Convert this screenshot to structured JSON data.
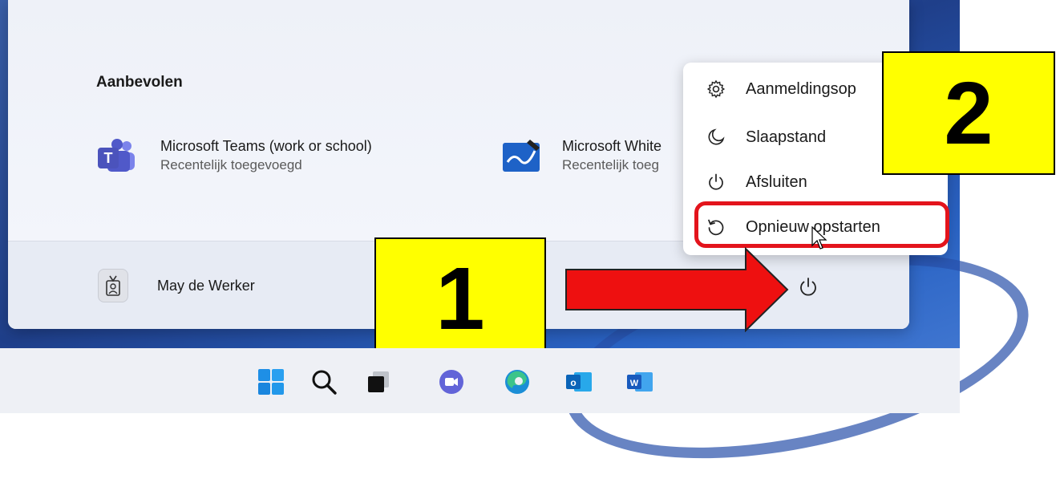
{
  "start_menu": {
    "recommended_title": "Aanbevolen",
    "items": [
      {
        "name": "Microsoft Teams (work or school)",
        "sub": "Recentelijk toegevoegd",
        "icon": "teams-icon"
      },
      {
        "name": "Microsoft White",
        "sub": "Recentelijk toeg",
        "icon": "whiteboard-icon"
      }
    ],
    "user_name": "May de Werker"
  },
  "power_menu": {
    "items": [
      {
        "label": "Aanmeldingsop",
        "icon": "gear-icon"
      },
      {
        "label": "Slaapstand",
        "icon": "moon-icon"
      },
      {
        "label": "Afsluiten",
        "icon": "power-icon"
      },
      {
        "label": "Opnieuw opstarten",
        "icon": "restart-icon"
      }
    ]
  },
  "callouts": {
    "one": "1",
    "two": "2"
  },
  "taskbar": {
    "icons": [
      "windows-start-icon",
      "search-icon",
      "task-view-icon",
      "teams-chat-icon",
      "edge-icon",
      "outlook-icon",
      "word-icon"
    ]
  },
  "colors": {
    "highlight": "#e3141c",
    "callout": "#ffff00",
    "arrow": "#ee1010"
  }
}
